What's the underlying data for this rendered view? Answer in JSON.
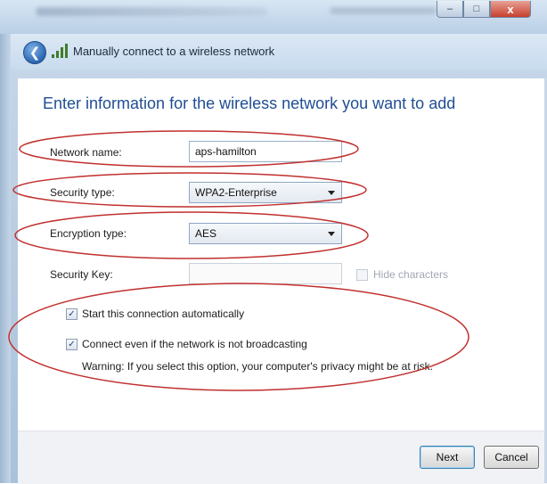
{
  "window": {
    "controls": {
      "minimize": "–",
      "maximize": "□",
      "close": "x"
    }
  },
  "nav": {
    "back_icon": "back-arrow-icon",
    "back_glyph": "❮",
    "network_icon": "wireless-network-icon",
    "title": "Manually connect to a wireless network"
  },
  "form": {
    "heading": "Enter information for the wireless network you want to add",
    "network_name": {
      "label": "Network name:",
      "value": "aps-hamilton"
    },
    "security_type": {
      "label": "Security type:",
      "value": "WPA2-Enterprise"
    },
    "encryption_type": {
      "label": "Encryption type:",
      "value": "AES"
    },
    "security_key": {
      "label": "Security Key:",
      "value": ""
    },
    "hide_characters": {
      "label": "Hide characters",
      "checked": false,
      "enabled": false
    },
    "start_auto": {
      "label": "Start this connection automatically",
      "checked": true,
      "check_glyph": "✓"
    },
    "connect_even": {
      "label": "Connect even if the network is not broadcasting",
      "checked": true,
      "check_glyph": "✓"
    },
    "warning": "Warning: If you select this option, your computer's privacy might be at risk."
  },
  "buttons": {
    "next": "Next",
    "cancel": "Cancel"
  },
  "colors": {
    "annotation": "#c0302e",
    "heading": "#1f4e94"
  }
}
